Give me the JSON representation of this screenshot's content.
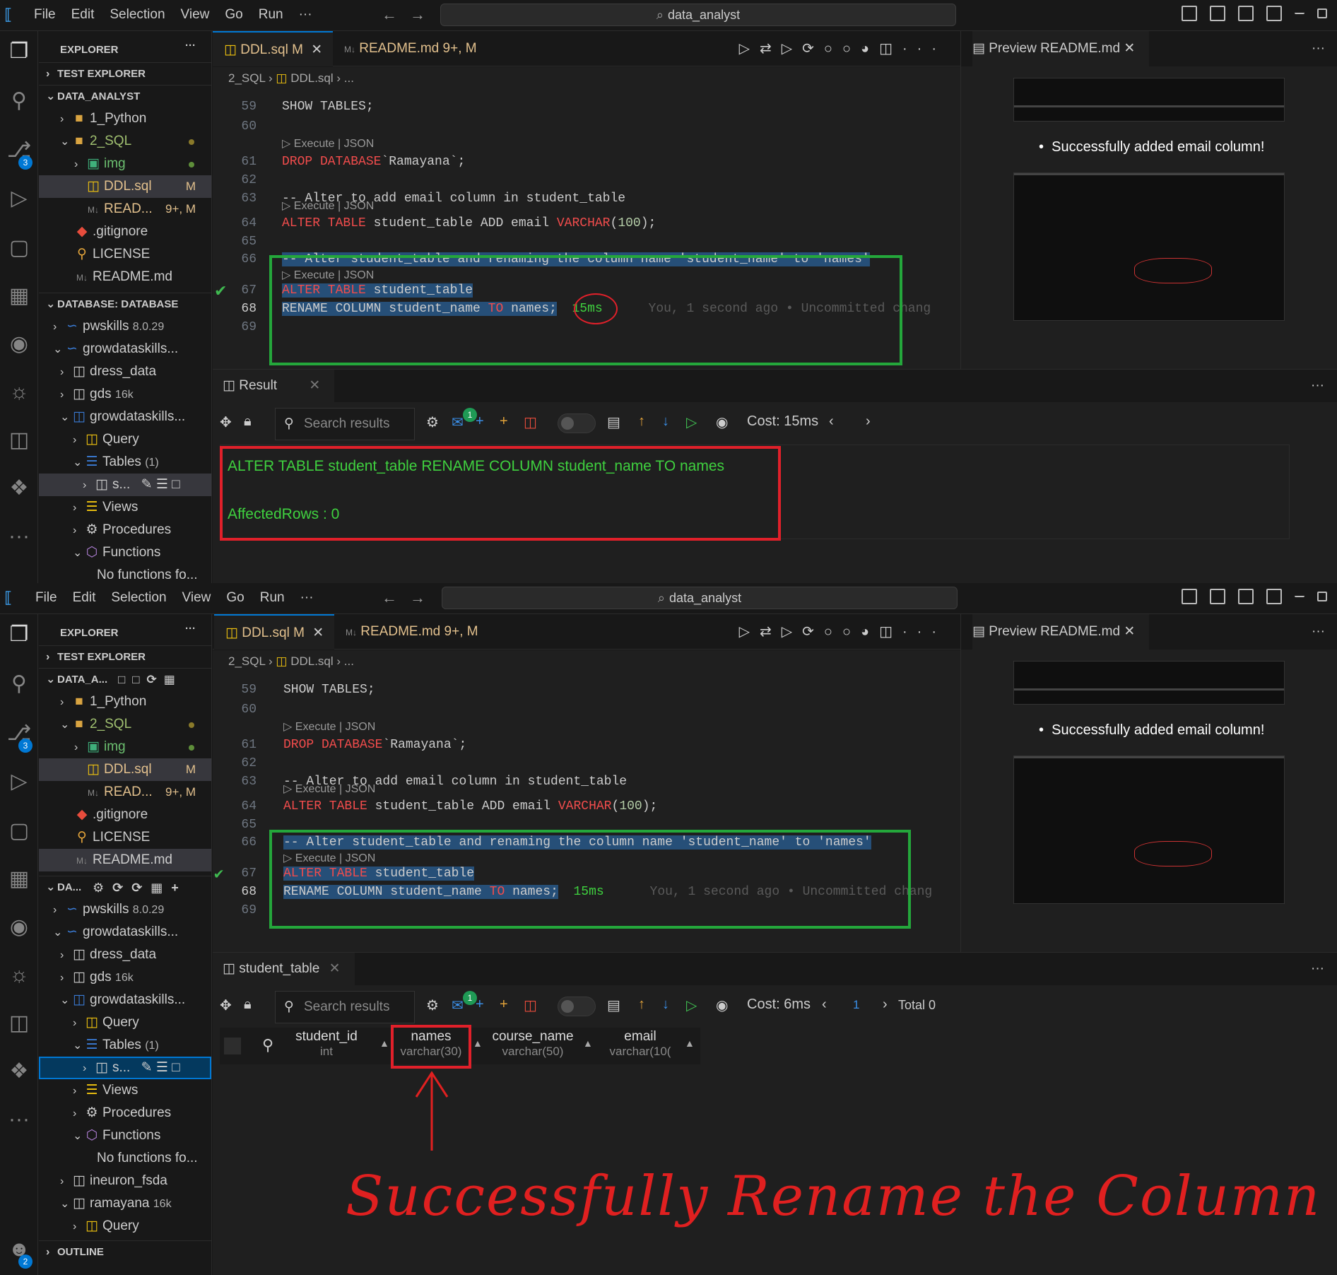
{
  "menu": [
    "File",
    "Edit",
    "Selection",
    "View",
    "Go",
    "Run",
    "···"
  ],
  "search": {
    "label": "data_analyst"
  },
  "sidebar": {
    "explorer_title": "EXPLORER",
    "test_explorer": "TEST EXPLORER",
    "folder_title_1": "DATA_ANALYST",
    "folder_title_2": "DATA_A...",
    "files": [
      {
        "name": "1_Python"
      },
      {
        "name": "2_SQL"
      },
      {
        "name": "img"
      },
      {
        "name": "DDL.sql",
        "badge": "M"
      },
      {
        "name": "READ...",
        "badge": "9+, M"
      },
      {
        "name": ".gitignore"
      },
      {
        "name": "LICENSE"
      },
      {
        "name": "README.md"
      }
    ],
    "database_title_1": "DATABASE: DATABASE",
    "database_title_2": "DA...",
    "db": [
      {
        "name": "pwskills",
        "sub": "8.0.29"
      },
      {
        "name": "growdataskills..."
      },
      {
        "name": "dress_data"
      },
      {
        "name": "gds",
        "sub": "16k"
      },
      {
        "name": "growdataskills..."
      },
      {
        "name": "Query"
      },
      {
        "name": "Tables",
        "sub": "(1)"
      },
      {
        "name": "s..."
      },
      {
        "name": "Views"
      },
      {
        "name": "Procedures"
      },
      {
        "name": "Functions"
      },
      {
        "name": "No functions fo..."
      },
      {
        "name": "ineuron_fsda"
      },
      {
        "name": "ramayana",
        "sub": "16k"
      },
      {
        "name": "Query"
      }
    ],
    "outline": "OUTLINE"
  },
  "activity_badges": {
    "scm": "3",
    "account": "2"
  },
  "tabs": [
    {
      "name": "DDL.sql",
      "status": "M"
    },
    {
      "name": "README.md",
      "status": "9+, M"
    }
  ],
  "breadcrumb": {
    "folder": "2_SQL",
    "file": "DDL.sql",
    "rest": "..."
  },
  "editor": {
    "codelens": "Execute | JSON",
    "line_numbers": [
      "59",
      "60",
      "61",
      "62",
      "63",
      "64",
      "65",
      "66",
      "67",
      "68",
      "69"
    ],
    "lines": {
      "l59": "SHOW TABLES;",
      "l61a": "DROP DATABASE",
      "l61b": "`Ramayana`;",
      "l63": "-- Alter to add email column in student_table",
      "l64a": "ALTER TABLE",
      "l64b": " student_table ADD email ",
      "l64c": "VARCHAR",
      "l64d": "(",
      "l64e": "100",
      "l64f": ");",
      "l66": "-- Alter student_table and renaming the column name 'student_name' to 'names'",
      "l67a": "ALTER TABLE",
      "l67b": " student_table",
      "l68a": "RENAME COLUMN student_name ",
      "l68b": "TO",
      "l68c": " names;",
      "timing": "15ms",
      "blame": "You, 1 second ago • Uncommitted chang"
    }
  },
  "preview": {
    "tab": "Preview README.md",
    "bullet": "Successfully added email column!"
  },
  "panel1": {
    "tab": "Result",
    "search_placeholder": "Search results",
    "cost": "Cost: 15ms",
    "mail_badge": "1",
    "result_line": "ALTER TABLE student_table  RENAME COLUMN student_name TO names",
    "affected": "AffectedRows : 0"
  },
  "panel2": {
    "tab": "student_table",
    "search_placeholder": "Search results",
    "cost": "Cost: 6ms",
    "mail_badge": "1",
    "page": "1",
    "total": "Total 0",
    "columns": [
      {
        "name": "student_id",
        "type": "int"
      },
      {
        "name": "names",
        "type": "varchar(30)"
      },
      {
        "name": "course_name",
        "type": "varchar(50)"
      },
      {
        "name": "email",
        "type": "varchar(10("
      }
    ]
  },
  "annotation": {
    "text": "Successfully Rename the Column name"
  },
  "colors": {
    "accent": "#0078d4",
    "keyword": "#f14c4c",
    "annotation_green": "#24a73b",
    "annotation_red": "#e0202a",
    "result_text": "#3fd13f"
  }
}
